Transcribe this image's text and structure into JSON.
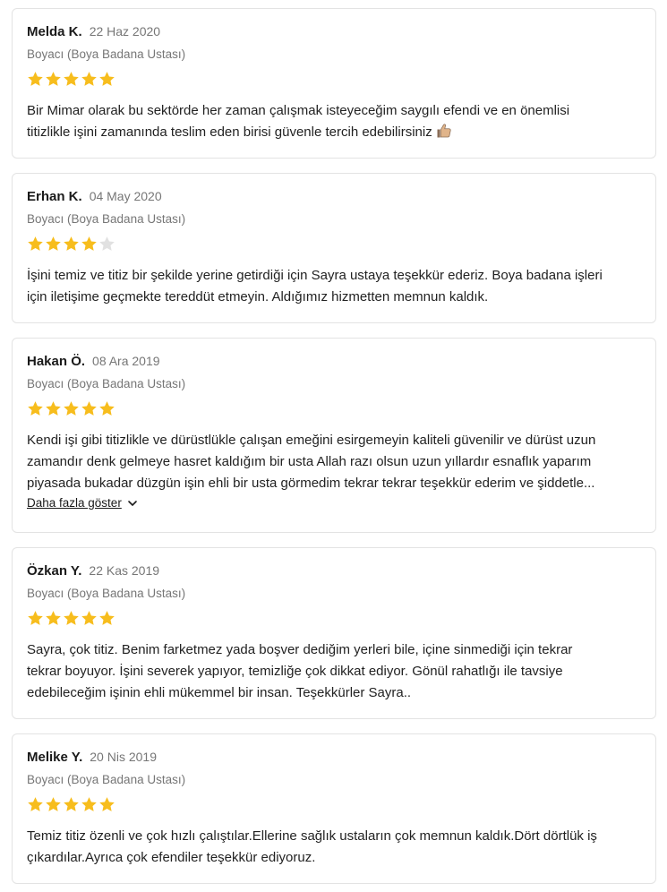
{
  "reviews": [
    {
      "name": "Melda K.",
      "date": "22 Haz 2020",
      "service": "Boyacı (Boya Badana Ustası)",
      "rating": 5,
      "text": "Bir Mimar olarak bu sektörde her zaman çalışmak isteyeceğim saygılı efendi ve en önemlisi\ntitizlikle işini zamanında teslim eden birisi güvenle tercih edebilirsiniz",
      "emoji": "thumbs-up-icon"
    },
    {
      "name": "Erhan K.",
      "date": "04 May 2020",
      "service": "Boyacı (Boya Badana Ustası)",
      "rating": 4,
      "text": "İşini temiz ve titiz bir şekilde yerine getirdiği için Sayra ustaya teşekkür ederiz. Boya badana işleri\niçin iletişime geçmekte tereddüt etmeyin. Aldığımız hizmetten memnun kaldık."
    },
    {
      "name": "Hakan Ö.",
      "date": "08 Ara 2019",
      "service": "Boyacı (Boya Badana Ustası)",
      "rating": 5,
      "text": "Kendi işi gibi titizlikle ve dürüstlükle çalışan emeğini esirgemeyin kaliteli güvenilir ve dürüst uzun\nzamandır denk gelmeye hasret kaldığım bir usta Allah razı olsun uzun yıllardır esnaflık yaparım\npiyasada bukadar düzgün işin ehli bir usta görmedim tekrar tekrar teşekkür ederim ve şiddetle...",
      "more_label": "Daha fazla göster"
    },
    {
      "name": "Özkan Y.",
      "date": "22 Kas 2019",
      "service": "Boyacı (Boya Badana Ustası)",
      "rating": 5,
      "text": "Sayra, çok titiz. Benim farketmez yada boşver dediğim yerleri bile, içine sinmediği için tekrar\ntekrar boyuyor. İşini severek yapıyor, temizliğe çok dikkat ediyor. Gönül rahatlığı ile tavsiye\nedebileceğim işinin ehli mükemmel bir insan. Teşekkürler Sayra.."
    },
    {
      "name": "Melike Y.",
      "date": "20 Nis 2019",
      "service": "Boyacı (Boya Badana Ustası)",
      "rating": 5,
      "text": "Temiz titiz özenli ve çok hızlı çalıştılar.Ellerine sağlık ustaların çok memnun kaldık.Dört dörtlük iş\nçıkardılar.Ayrıca çok efendiler teşekkür ediyoruz."
    }
  ],
  "colors": {
    "star_filled": "#f7bd1d",
    "star_empty": "#e1e1e1",
    "muted_text": "#767676",
    "border": "#e3e3e3"
  }
}
